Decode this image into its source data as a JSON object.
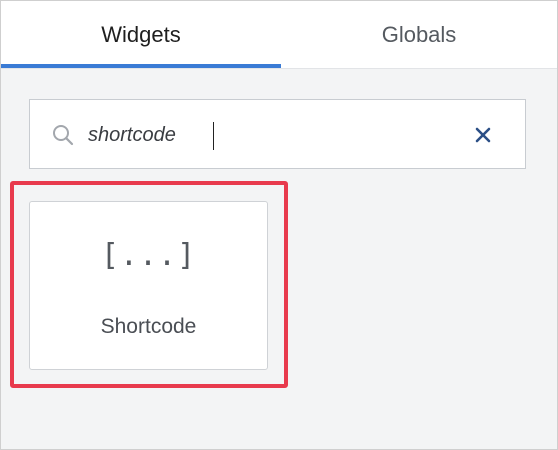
{
  "tabs": [
    {
      "label": "Widgets",
      "active": true
    },
    {
      "label": "Globals",
      "active": false
    }
  ],
  "search": {
    "value": "shortcode",
    "icon": "search-icon",
    "clear_icon": "close-icon"
  },
  "results": [
    {
      "icon_glyph": "[...]",
      "icon": "shortcode-icon",
      "label": "Shortcode",
      "highlighted": true
    }
  ],
  "colors": {
    "active_tab_underline": "#3a7bd5",
    "highlight_border": "#e83a4d",
    "clear_icon": "#2b4f86",
    "panel_background": "#f3f4f5"
  }
}
